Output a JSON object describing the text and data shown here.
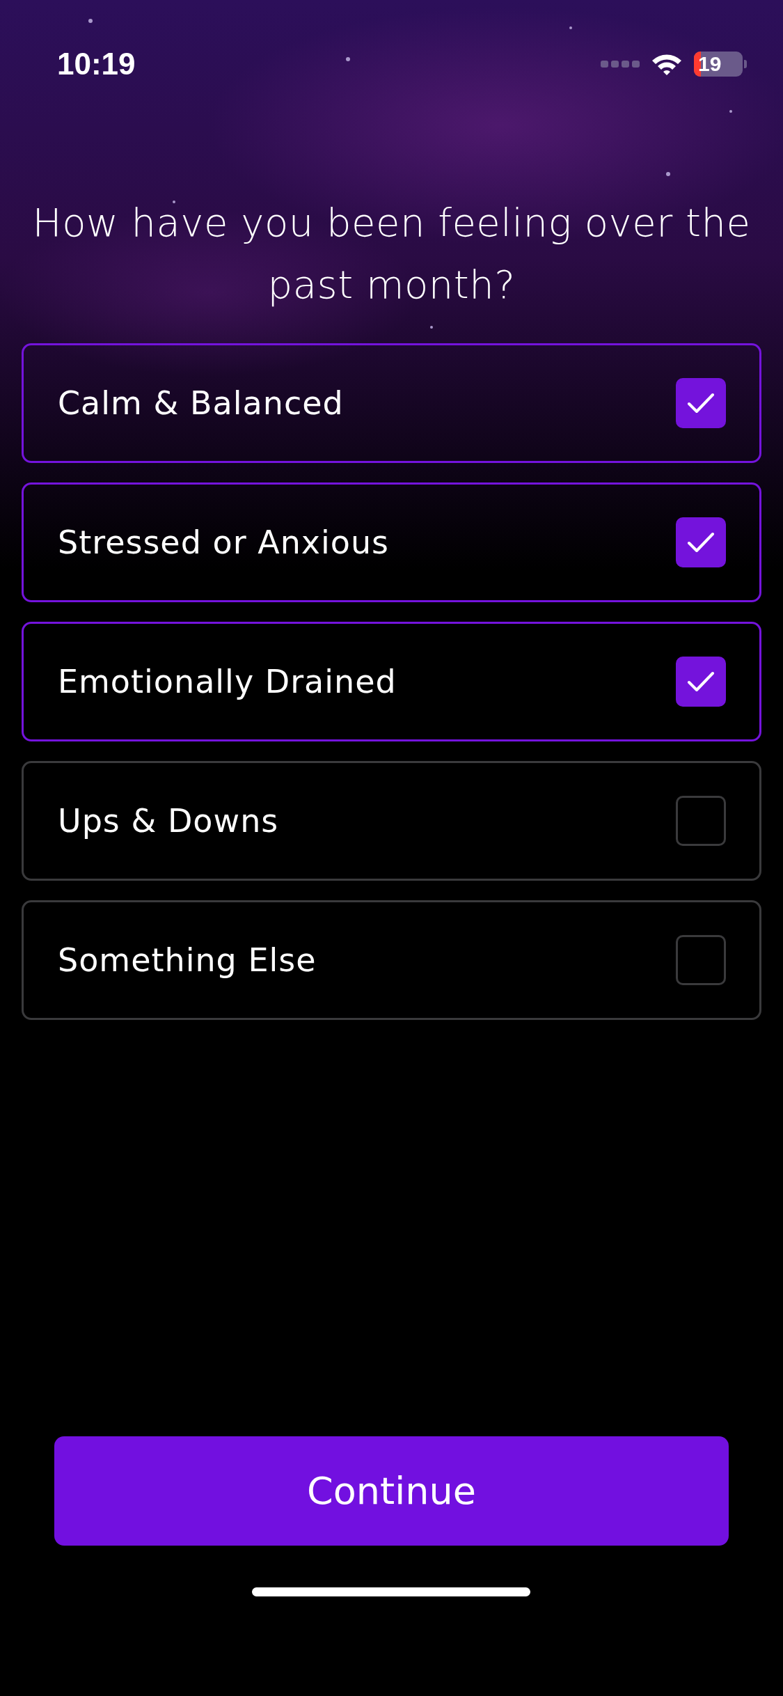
{
  "status_bar": {
    "time": "10:19",
    "battery": "19"
  },
  "question": "How have you been feeling over the past month?",
  "options": [
    {
      "label": "Calm & Balanced",
      "checked": true
    },
    {
      "label": "Stressed or Anxious",
      "checked": true
    },
    {
      "label": "Emotionally Drained",
      "checked": true
    },
    {
      "label": "Ups & Downs",
      "checked": false
    },
    {
      "label": "Something Else",
      "checked": false
    }
  ],
  "continue_button": "Continue"
}
